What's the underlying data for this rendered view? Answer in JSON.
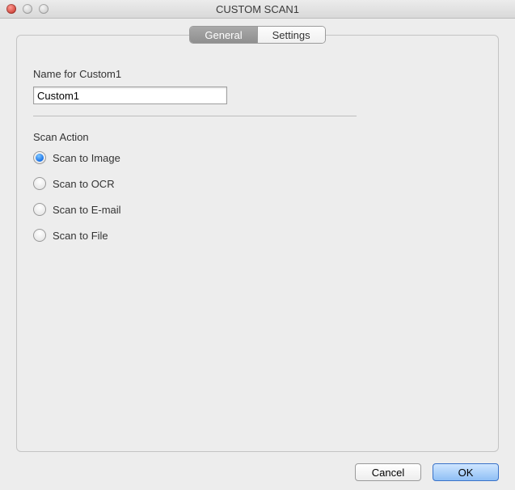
{
  "window": {
    "title": "CUSTOM SCAN1"
  },
  "tabs": {
    "general": "General",
    "settings": "Settings",
    "active": "general"
  },
  "name_field": {
    "label": "Name for Custom1",
    "value": "Custom1"
  },
  "scan_action": {
    "label": "Scan Action",
    "options": {
      "image": "Scan to Image",
      "ocr": "Scan to OCR",
      "email": "Scan to E-mail",
      "file": "Scan to File"
    },
    "selected": "image"
  },
  "buttons": {
    "cancel": "Cancel",
    "ok": "OK"
  }
}
